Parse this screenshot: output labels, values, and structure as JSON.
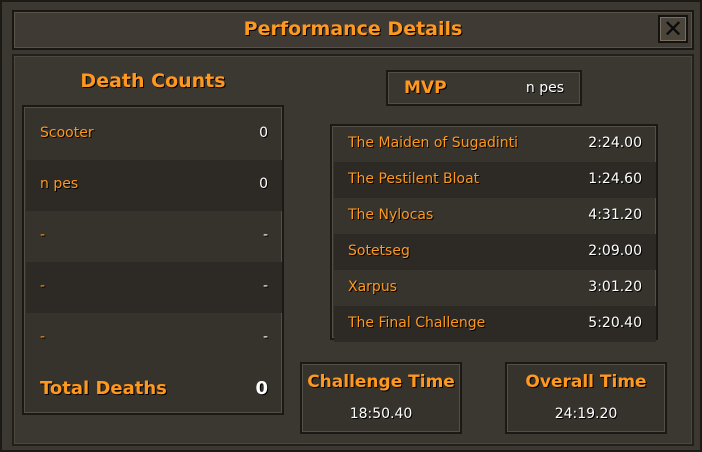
{
  "window": {
    "title": "Performance Details",
    "close_label": "✕"
  },
  "death_counts": {
    "title": "Death Counts",
    "rows": [
      {
        "name": "Scooter",
        "value": "0"
      },
      {
        "name": "n pes",
        "value": "0"
      },
      {
        "name": "-",
        "value": "-"
      },
      {
        "name": "-",
        "value": "-"
      },
      {
        "name": "-",
        "value": "-"
      }
    ],
    "total_label": "Total Deaths",
    "total_value": "0"
  },
  "mvp": {
    "label": "MVP",
    "value": "n pes"
  },
  "splits": [
    {
      "name": "The Maiden of Sugadinti",
      "time": "2:24.00"
    },
    {
      "name": "The Pestilent Bloat",
      "time": "1:24.60"
    },
    {
      "name": "The Nylocas",
      "time": "4:31.20"
    },
    {
      "name": "Sotetseg",
      "time": "2:09.00"
    },
    {
      "name": "Xarpus",
      "time": "3:01.20"
    },
    {
      "name": "The Final Challenge",
      "time": "5:20.40"
    }
  ],
  "challenge_time": {
    "label": "Challenge Time",
    "value": "18:50.40"
  },
  "overall_time": {
    "label": "Overall Time",
    "value": "24:19.20"
  },
  "colors": {
    "accent": "#ff981f",
    "text": "#ffffff",
    "background": "#3b3731"
  }
}
